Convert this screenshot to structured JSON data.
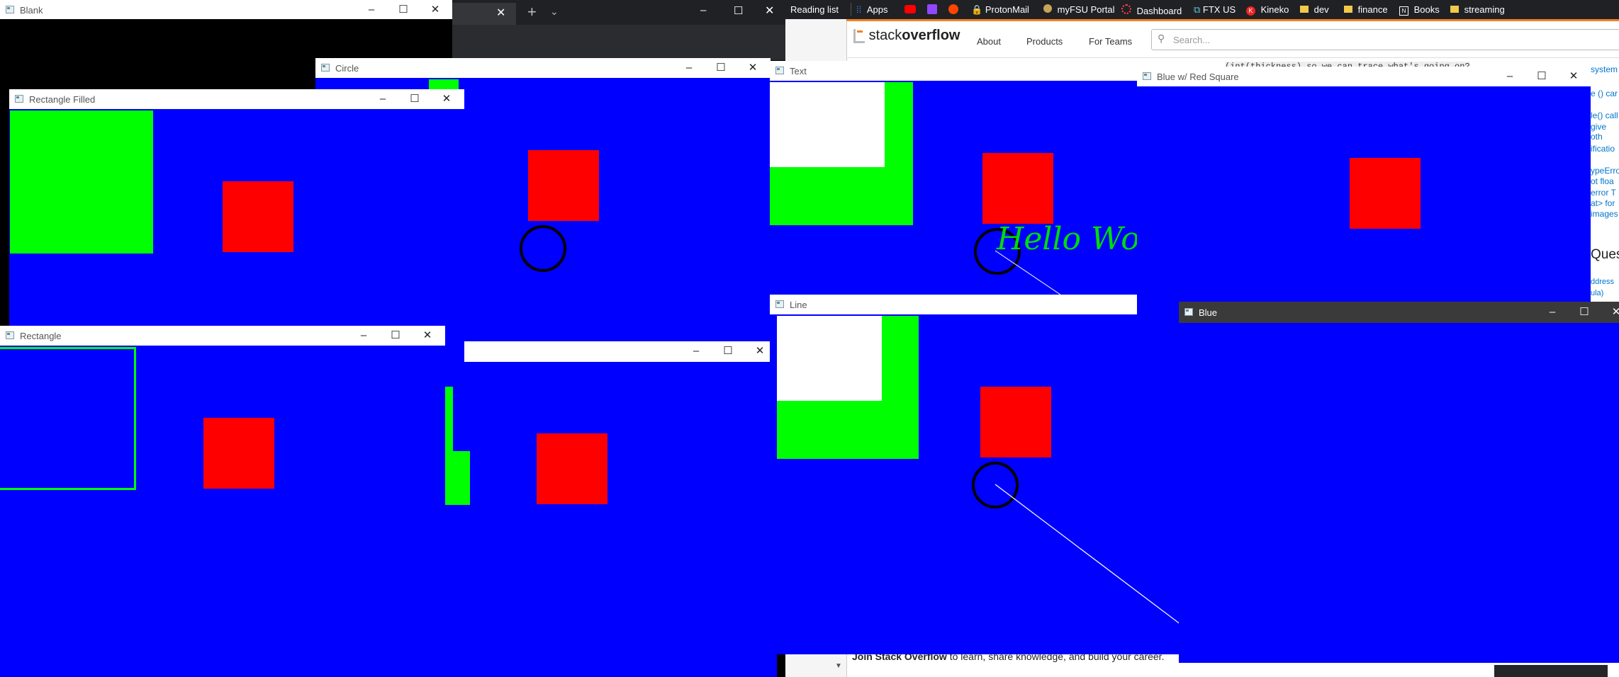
{
  "browser": {
    "bookmarks_bar": {
      "reading_list": "Reading list",
      "items": [
        {
          "label": "Apps",
          "icon": "apps-grid-icon"
        },
        {
          "label": "",
          "icon": "youtube-icon"
        },
        {
          "label": "",
          "icon": "twitch-icon"
        },
        {
          "label": "",
          "icon": "reddit-icon"
        },
        {
          "label": "ProtonMail",
          "icon": "protonmail-icon"
        },
        {
          "label": "myFSU Portal",
          "icon": "fsu-icon"
        },
        {
          "label": "Dashboard",
          "icon": "dashboard-icon"
        },
        {
          "label": "FTX US",
          "icon": "ftx-icon"
        },
        {
          "label": "Kineko",
          "icon": "kineko-icon"
        },
        {
          "label": "dev",
          "icon": "folder-icon"
        },
        {
          "label": "finance",
          "icon": "folder-icon"
        },
        {
          "label": "Books",
          "icon": "notion-icon"
        },
        {
          "label": "streaming",
          "icon": "folder-icon"
        }
      ]
    },
    "stackoverflow": {
      "logo_text_plain": "stack",
      "logo_text_bold": "overflow",
      "nav": [
        "About",
        "Products",
        "For Teams"
      ],
      "search_placeholder": "Search...",
      "code_snippet": "(int(thickness) so we can trace what's going on?",
      "right_snippets": [
        "system",
        "e () car",
        "le() call",
        "give oth",
        "ificatio",
        "ypeErro",
        "ot floa",
        "error T",
        "at> for",
        "images",
        "Ques",
        "ddress",
        "ula)"
      ],
      "footer_text_bold": "Join Stack Overflow",
      "footer_text": " to learn, share knowledge, and build your career."
    }
  },
  "windows": {
    "blank": {
      "title": "Blank"
    },
    "circle": {
      "title": "Circle"
    },
    "rectangle_filled": {
      "title": "Rectangle Filled"
    },
    "rectangle": {
      "title": "Rectangle"
    },
    "untitled": {
      "title": ""
    },
    "text": {
      "title": "Text",
      "hello_text": "Hello World"
    },
    "line": {
      "title": "Line"
    },
    "blue_red_square": {
      "title": "Blue w/ Red Square"
    },
    "blue": {
      "title": "Blue"
    }
  },
  "window_controls": {
    "minimize": "–",
    "maximize": "☐",
    "close": "✕"
  },
  "colors": {
    "canvas_blue": "#0000ff",
    "square_red": "#ff0000",
    "rect_green": "#00ff00"
  }
}
